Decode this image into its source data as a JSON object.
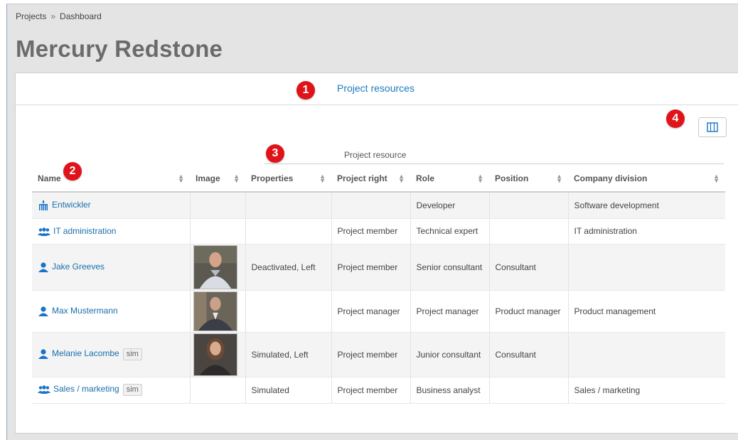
{
  "breadcrumb": {
    "items": [
      "Projects",
      "Dashboard"
    ],
    "separator": "»"
  },
  "page": {
    "title": "Mercury Redstone"
  },
  "tabs": {
    "active_label": "Project resources"
  },
  "callouts": {
    "one": "1",
    "two": "2",
    "three": "3",
    "four": "4",
    "color": "#e0131a"
  },
  "toolbar": {
    "columns_button_icon": "columns-icon"
  },
  "table": {
    "caption": "Project resource",
    "headers": {
      "name": "Name",
      "image": "Image",
      "properties": "Properties",
      "project_right": "Project right",
      "role": "Role",
      "position": "Position",
      "company_division": "Company division"
    },
    "rows": [
      {
        "icon": "org-chart-icon",
        "name": "Entwickler",
        "sim": "",
        "image": "",
        "properties": "",
        "project_right": "",
        "role": "Developer",
        "position": "",
        "company_division": "Software development"
      },
      {
        "icon": "group-icon",
        "name": "IT administration",
        "sim": "",
        "image": "",
        "properties": "",
        "project_right": "Project member",
        "role": "Technical expert",
        "position": "",
        "company_division": "IT administration"
      },
      {
        "icon": "person-icon",
        "name": "Jake Greeves",
        "sim": "",
        "image": "photo-man-light-shirt",
        "properties": "Deactivated, Left",
        "project_right": "Project member",
        "role": "Senior consultant",
        "position": "Consultant",
        "company_division": ""
      },
      {
        "icon": "person-icon",
        "name": "Max Mustermann",
        "sim": "",
        "image": "photo-man-suit",
        "properties": "",
        "project_right": "Project manager",
        "role": "Project manager",
        "position": "Product manager",
        "company_division": "Product management"
      },
      {
        "icon": "person-icon",
        "name": "Melanie Lacombe",
        "sim": "sim",
        "image": "photo-woman",
        "properties": "Simulated, Left",
        "project_right": "Project member",
        "role": "Junior consultant",
        "position": "Consultant",
        "company_division": ""
      },
      {
        "icon": "group-icon",
        "name": "Sales / marketing",
        "sim": "sim",
        "image": "",
        "properties": "Simulated",
        "project_right": "Project member",
        "role": "Business analyst",
        "position": "",
        "company_division": "Sales / marketing"
      }
    ]
  },
  "colors": {
    "link": "#1a6fae",
    "accent": "#1a7bbf",
    "icon_blue": "#1a73c8"
  }
}
